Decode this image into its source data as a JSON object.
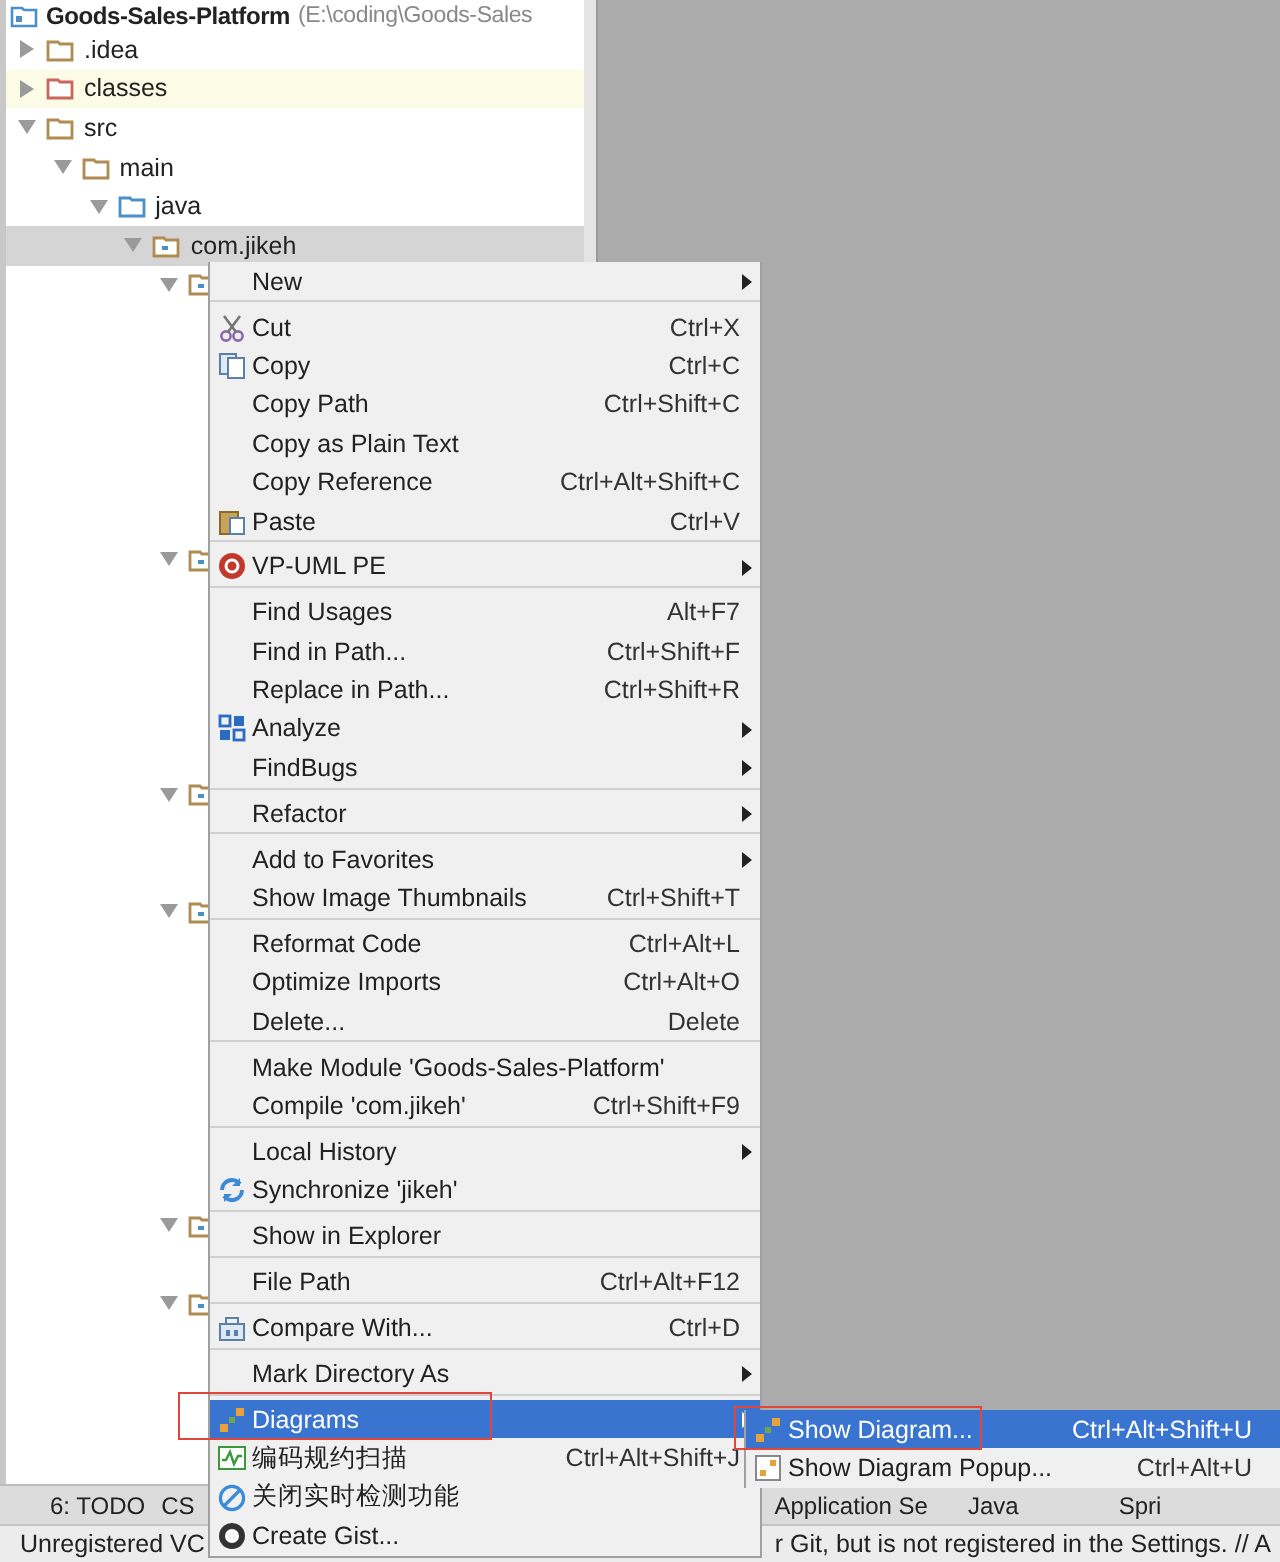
{
  "project_tree": {
    "root": {
      "label": "Goods-Sales-Platform",
      "path": "(E:\\coding\\Goods-Sales"
    },
    "items": [
      {
        "label": ".idea",
        "kind": "folder",
        "expanded": false,
        "selected": false
      },
      {
        "label": "classes",
        "kind": "excluded",
        "expanded": false,
        "selected": false
      },
      {
        "label": "src",
        "kind": "folder",
        "expanded": true,
        "selected": false,
        "children": [
          {
            "label": "main",
            "kind": "folder",
            "expanded": true,
            "selected": false,
            "children": [
              {
                "label": "java",
                "kind": "source",
                "expanded": true,
                "selected": false,
                "children": [
                  {
                    "label": "com.jikeh",
                    "kind": "package",
                    "expanded": true,
                    "selected": true,
                    "children": [
                      {
                        "kind": "package",
                        "expanded": true
                      },
                      {
                        "kind": "package",
                        "expanded": true
                      },
                      {
                        "kind": "package",
                        "expanded": true
                      },
                      {
                        "kind": "package",
                        "expanded": true
                      },
                      {
                        "kind": "package",
                        "expanded": true
                      },
                      {
                        "kind": "package",
                        "expanded": true
                      }
                    ]
                  }
                ]
              }
            ]
          }
        ]
      }
    ]
  },
  "tool_strip": [
    {
      "label": "6: TODO",
      "kind": "todo"
    },
    {
      "label": "CS",
      "kind": "cs"
    },
    {
      "label": "Application Se",
      "kind": "app"
    },
    {
      "label": "Java",
      "kind": "java"
    },
    {
      "label": "Spri",
      "kind": "spring"
    }
  ],
  "status_bar": {
    "left": "Unregistered VC",
    "right": "r Git, but is not registered in the Settings. // A"
  },
  "context_menu": [
    {
      "kind": "plain",
      "label": "New",
      "submenu": true,
      "selected": false
    },
    {
      "kind": "separator"
    },
    {
      "kind": "cut",
      "label": "Cut",
      "shortcut": "Ctrl+X",
      "submenu": false,
      "selected": false
    },
    {
      "kind": "copy",
      "label": "Copy",
      "shortcut": "Ctrl+C",
      "submenu": false,
      "selected": false
    },
    {
      "kind": "plain",
      "label": "Copy Path",
      "shortcut": "Ctrl+Shift+C",
      "submenu": false,
      "selected": false
    },
    {
      "kind": "plain",
      "label": "Copy as Plain Text",
      "submenu": false,
      "selected": false
    },
    {
      "kind": "plain",
      "label": "Copy Reference",
      "shortcut": "Ctrl+Alt+Shift+C",
      "submenu": false,
      "selected": false
    },
    {
      "kind": "paste",
      "label": "Paste",
      "shortcut": "Ctrl+V",
      "submenu": false,
      "selected": false
    },
    {
      "kind": "separator"
    },
    {
      "kind": "vp",
      "label": "VP-UML PE",
      "submenu": true,
      "selected": false
    },
    {
      "kind": "separator"
    },
    {
      "kind": "plain",
      "label": "Find Usages",
      "shortcut": "Alt+F7",
      "submenu": false,
      "selected": false
    },
    {
      "kind": "plain",
      "label": "Find in Path...",
      "shortcut": "Ctrl+Shift+F",
      "submenu": false,
      "selected": false
    },
    {
      "kind": "plain",
      "label": "Replace in Path...",
      "shortcut": "Ctrl+Shift+R",
      "submenu": false,
      "selected": false
    },
    {
      "kind": "analyze",
      "label": "Analyze",
      "submenu": true,
      "selected": false
    },
    {
      "kind": "plain",
      "label": "FindBugs",
      "submenu": true,
      "selected": false
    },
    {
      "kind": "separator"
    },
    {
      "kind": "plain",
      "label": "Refactor",
      "submenu": true,
      "selected": false
    },
    {
      "kind": "separator"
    },
    {
      "kind": "plain",
      "label": "Add to Favorites",
      "submenu": true,
      "selected": false
    },
    {
      "kind": "plain",
      "label": "Show Image Thumbnails",
      "shortcut": "Ctrl+Shift+T",
      "submenu": false,
      "selected": false
    },
    {
      "kind": "separator"
    },
    {
      "kind": "plain",
      "label": "Reformat Code",
      "shortcut": "Ctrl+Alt+L",
      "submenu": false,
      "selected": false
    },
    {
      "kind": "plain",
      "label": "Optimize Imports",
      "shortcut": "Ctrl+Alt+O",
      "submenu": false,
      "selected": false
    },
    {
      "kind": "plain",
      "label": "Delete...",
      "shortcut": "Delete",
      "submenu": false,
      "selected": false
    },
    {
      "kind": "separator"
    },
    {
      "kind": "plain",
      "label": "Make Module 'Goods-Sales-Platform'",
      "submenu": false,
      "selected": false
    },
    {
      "kind": "plain",
      "label": "Compile 'com.jikeh'",
      "shortcut": "Ctrl+Shift+F9",
      "submenu": false,
      "selected": false
    },
    {
      "kind": "separator"
    },
    {
      "kind": "plain",
      "label": "Local History",
      "submenu": true,
      "selected": false
    },
    {
      "kind": "sync",
      "label": "Synchronize 'jikeh'",
      "submenu": false,
      "selected": false
    },
    {
      "kind": "separator"
    },
    {
      "kind": "plain",
      "label": "Show in Explorer",
      "submenu": false,
      "selected": false
    },
    {
      "kind": "separator"
    },
    {
      "kind": "plain",
      "label": "File Path",
      "shortcut": "Ctrl+Alt+F12",
      "submenu": false,
      "selected": false
    },
    {
      "kind": "separator"
    },
    {
      "kind": "compare",
      "label": "Compare With...",
      "shortcut": "Ctrl+D",
      "submenu": false,
      "selected": false
    },
    {
      "kind": "separator"
    },
    {
      "kind": "plain",
      "label": "Mark Directory As",
      "submenu": true,
      "selected": false
    },
    {
      "kind": "separator"
    },
    {
      "kind": "diagram",
      "label": "Diagrams",
      "submenu": true,
      "selected": true,
      "highlight": true
    },
    {
      "kind": "scan",
      "label": "编码规约扫描",
      "shortcut": "Ctrl+Alt+Shift+J",
      "submenu": false,
      "selected": false
    },
    {
      "kind": "disable",
      "label": "关闭实时检测功能",
      "submenu": false,
      "selected": false
    },
    {
      "kind": "gist",
      "label": "Create Gist...",
      "submenu": false,
      "selected": false
    }
  ],
  "submenu": [
    {
      "kind": "diagram",
      "label": "Show Diagram...",
      "shortcut": "Ctrl+Alt+Shift+U",
      "selected": true,
      "highlight": true
    },
    {
      "kind": "popup",
      "label": "Show Diagram Popup...",
      "shortcut": "Ctrl+Alt+U",
      "selected": false,
      "highlight": false
    }
  ]
}
